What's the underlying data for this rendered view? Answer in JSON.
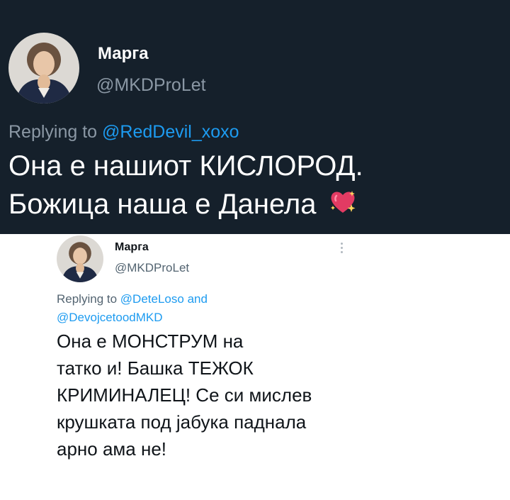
{
  "tweet_dark": {
    "name": "Марга",
    "handle": "@MKDProLet",
    "reply_prefix": "Replying to",
    "reply_mention": "@RedDevil_xoxo",
    "line1": "Она е нашиот КИСЛОРОД.",
    "line2": "Божица наша е Данела",
    "emoji_icon": "sparkling-heart-icon",
    "colors": {
      "background": "#15202b",
      "text": "#ffffff",
      "secondary": "#8b98a5",
      "link": "#1d9bf0"
    }
  },
  "tweet_light": {
    "name": "Марга",
    "handle": "@MKDProLet",
    "reply_prefix": "Replying to",
    "reply_mention_1": "@DeteLoso",
    "reply_and": "and",
    "reply_mention_2": "@DevojcetoodMKD",
    "body_lines": [
      "Она е МОНСТРУМ на",
      "татко и! Башка ТЕЖОК",
      "КРИМИНАЛЕЦ! Се си мислев",
      "крушката под јабука паднала",
      "арно ама не!"
    ],
    "more_icon": "more-options-icon",
    "colors": {
      "background": "#ffffff",
      "text": "#0f1419",
      "secondary": "#536471",
      "link": "#1d9bf0"
    }
  }
}
